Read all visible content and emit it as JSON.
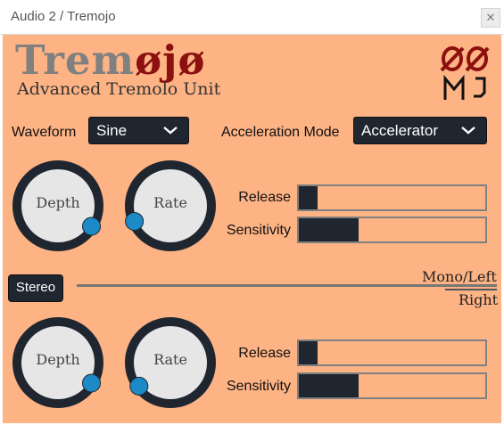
{
  "window": {
    "title": "Audio 2 / Tremojo",
    "close_label": "✕"
  },
  "brand": {
    "name_prefix": "Trem",
    "name_oo": "øjø",
    "subtitle": "Advanced Tremolo Unit"
  },
  "controls": {
    "waveform_label": "Waveform",
    "waveform_value": "Sine",
    "acceleration_label": "Acceleration Mode",
    "acceleration_value": "Accelerator"
  },
  "channel_top": {
    "depth": {
      "label": "Depth",
      "level": 0.95
    },
    "rate": {
      "label": "Rate",
      "level": 0.08
    },
    "release": {
      "label": "Release",
      "level": 0.1
    },
    "sensitivity": {
      "label": "Sensitivity",
      "level": 0.32
    }
  },
  "channel_bottom": {
    "depth": {
      "label": "Depth",
      "level": 0.95
    },
    "rate": {
      "label": "Rate",
      "level": 0.03
    },
    "release": {
      "label": "Release",
      "level": 0.1
    },
    "sensitivity": {
      "label": "Sensitivity",
      "level": 0.32
    }
  },
  "stereo": {
    "button_label": "Stereo",
    "mono_label": "Mono/Left",
    "right_label": "Right"
  },
  "colors": {
    "panel": "#fdb384",
    "dark": "#1f2630",
    "accent": "#1b8ac6",
    "brand_red": "#8b1010"
  }
}
